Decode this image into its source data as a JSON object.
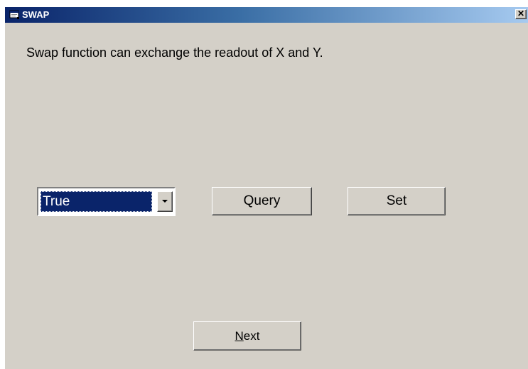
{
  "window": {
    "title": "SWAP",
    "app_icon": "window-app-icon",
    "close_icon": "close-icon",
    "close_label": "✕"
  },
  "description": "Swap function can exchange the readout of X and Y.",
  "swap_select": {
    "selected_value": "True",
    "dropdown_icon": "chevron-down-icon"
  },
  "buttons": {
    "query_label": "Query",
    "set_label": "Set",
    "next_mnemonic": "N",
    "next_rest": "ext"
  },
  "colors": {
    "face": "#d4d0c8",
    "title_active": "#0a246a",
    "selection": "#0a246a"
  }
}
